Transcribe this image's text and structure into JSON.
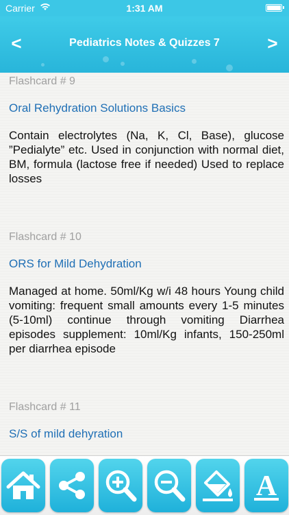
{
  "status_bar": {
    "carrier": "Carrier",
    "time": "1:31 AM"
  },
  "nav": {
    "title": "Pediatrics Notes & Quizzes 7",
    "back_label": "<",
    "forward_label": ">"
  },
  "flashcards": [
    {
      "number": "Flashcard # 9",
      "title": "Oral Rehydration Solutions Basics",
      "body": "Contain electrolytes (Na, K, Cl, Base), glucose ”Pedialyte” etc. Used in conjunction with normal diet, BM, formula (lactose free if needed) Used to replace losses"
    },
    {
      "number": "Flashcard # 10",
      "title": "ORS for Mild Dehydration",
      "body": "Managed at home. 50ml/Kg w/i 48 hours Young child vomiting: frequent small amounts every 1-5 minutes (5-10ml) continue through vomiting Diarrhea episodes supplement: 10ml/Kg infants, 150-250ml per diarrhea episode"
    },
    {
      "number": "Flashcard # 11",
      "title": "S/S of mild dehyration",
      "body": ""
    }
  ],
  "toolbar": {
    "buttons": [
      {
        "icon": "home-icon"
      },
      {
        "icon": "share-icon"
      },
      {
        "icon": "zoom-in-icon"
      },
      {
        "icon": "zoom-out-icon"
      },
      {
        "icon": "paint-bucket-icon"
      },
      {
        "icon": "font-icon",
        "glyph": "A"
      }
    ]
  },
  "colors": {
    "accent": "#2bb9dd",
    "title_link": "#1f6fb5",
    "card_number": "#a0a0a0"
  }
}
